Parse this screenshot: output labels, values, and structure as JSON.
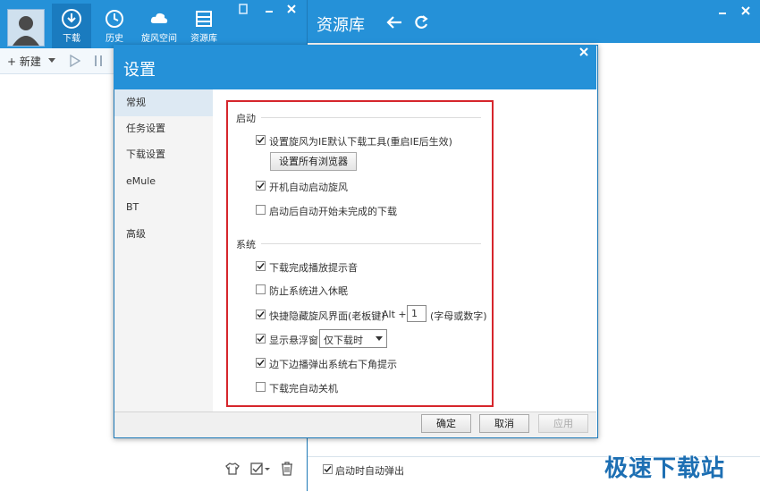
{
  "left_app": {
    "tabs": [
      {
        "label": "下载",
        "icon": "download-icon"
      },
      {
        "label": "历史",
        "icon": "history-icon"
      },
      {
        "label": "旋风空间",
        "icon": "cloud-icon"
      },
      {
        "label": "资源库",
        "icon": "library-icon"
      }
    ],
    "new_button": "+ 新建"
  },
  "resource_window": {
    "title": "资源库",
    "autopopup_label": "启动时自动弹出",
    "autopopup_checked": true
  },
  "settings": {
    "title": "设置",
    "sidebar": [
      "常规",
      "任务设置",
      "下载设置",
      "eMule",
      "BT",
      "高级"
    ],
    "selected_index": 0,
    "sections": {
      "startup": {
        "title": "启动",
        "items": [
          {
            "label": "设置旋风为IE默认下载工具(重启IE后生效)",
            "checked": true
          },
          {
            "label": "开机自动启动旋风",
            "checked": true
          },
          {
            "label": "启动后自动开始未完成的下载",
            "checked": false
          }
        ],
        "set_browsers_button": "设置所有浏览器"
      },
      "system": {
        "title": "系统",
        "items": [
          {
            "label": "下载完成播放提示音",
            "checked": true
          },
          {
            "label": "防止系统进入休眠",
            "checked": false
          },
          {
            "label": "快捷隐藏旋风界面(老板键)",
            "checked": true
          },
          {
            "label": "显示悬浮窗",
            "checked": true
          },
          {
            "label": "边下边播弹出系统右下角提示",
            "checked": true
          },
          {
            "label": "下载完自动关机",
            "checked": false
          }
        ],
        "hotkey_prefix": "Alt +",
        "hotkey_value": "1",
        "hotkey_hint": "(字母或数字)",
        "float_window_option": "仅下载时"
      }
    },
    "buttons": {
      "ok": "确定",
      "cancel": "取消",
      "apply": "应用"
    }
  },
  "watermark": "极速下载站",
  "colors": {
    "titlebar": "#2591d8",
    "highlight_box": "#d6262c",
    "accent": "#1d79b7"
  }
}
